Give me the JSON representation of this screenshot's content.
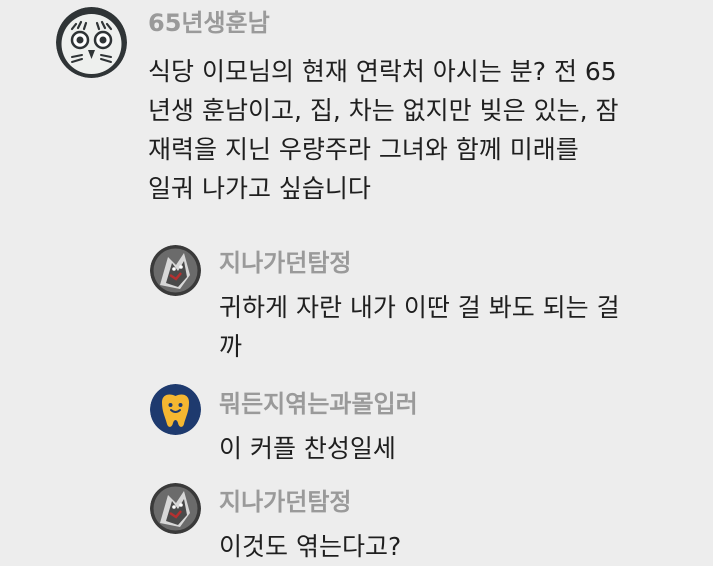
{
  "comments": [
    {
      "username": "65년생훈남",
      "avatar_icon": "owl-face-icon",
      "lines": [
        "식당 이모님의 현재 연락처 아시는 분? 전 65",
        "년생 훈남이고, 집, 차는 없지만 빚은 있는, 잠",
        "재력을 지닌 우량주라 그녀와 함께 미래를",
        "일궈 나가고 싶습니다"
      ]
    },
    {
      "username": "지나가던탐정",
      "avatar_icon": "dark-character-icon",
      "lines": [
        "귀하게 자란 내가 이딴 걸 봐도 되는 걸",
        "까"
      ]
    },
    {
      "username": "뭐든지엮는과몰입러",
      "avatar_icon": "tooth-face-icon",
      "lines": [
        "이 커플 찬성일세"
      ]
    },
    {
      "username": "지나가던탐정",
      "avatar_icon": "dark-character-icon",
      "lines": [
        "이것도 엮는다고?"
      ]
    }
  ],
  "colors": {
    "background": "#ededed",
    "username": "#9a9a9a",
    "text": "#1f1f1f",
    "tooth_avatar_bg": "#1e3a6e",
    "tooth_color": "#f5b731"
  }
}
